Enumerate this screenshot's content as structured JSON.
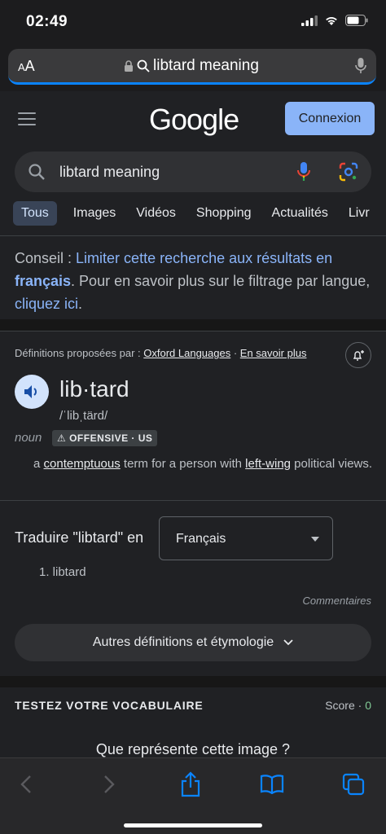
{
  "status_bar": {
    "time": "02:49"
  },
  "url_bar": {
    "aa": "AA",
    "url_text": "libtard meaning"
  },
  "google": {
    "logo": "Google",
    "connexion": "Connexion"
  },
  "search": {
    "query": "libtard meaning"
  },
  "tabs": [
    {
      "label": "Tous",
      "active": true
    },
    {
      "label": "Images"
    },
    {
      "label": "Vidéos"
    },
    {
      "label": "Shopping"
    },
    {
      "label": "Actualités"
    },
    {
      "label": "Livr"
    }
  ],
  "conseil": {
    "prefix": "Conseil : ",
    "link1": "Limiter cette recherche aux résultats en ",
    "link1_bold": "français",
    "middle": ". Pour en savoir plus sur le filtrage par langue, ",
    "link2": "cliquez ici",
    "suffix": "."
  },
  "definition": {
    "source_prefix": "Définitions proposées par : ",
    "source_name": "Oxford Languages",
    "sep": " · ",
    "learn_more": "En savoir plus",
    "word": "lib·tard",
    "phonetic": "/ˈlibˌtärd/",
    "part_of_speech": "noun",
    "badge": "⚠ OFFENSIVE · US",
    "text_a": "a ",
    "text_link1": "contemptuous",
    "text_b": " term for a person with ",
    "text_link2": "left-wing",
    "text_c": " political views."
  },
  "translate": {
    "label": "Traduire \"libtard\" en",
    "language": "Français",
    "item": "1. libtard",
    "comments": "Commentaires"
  },
  "more_button": "Autres définitions et étymologie",
  "vocab": {
    "title": "TESTEZ VOTRE VOCABULAIRE",
    "score_label": "Score · ",
    "score_value": "0",
    "question": "Que représente cette image ?"
  },
  "colors": {
    "accent": "#8ab4f8",
    "background": "#202124",
    "safari_blue": "#0a84ff"
  }
}
